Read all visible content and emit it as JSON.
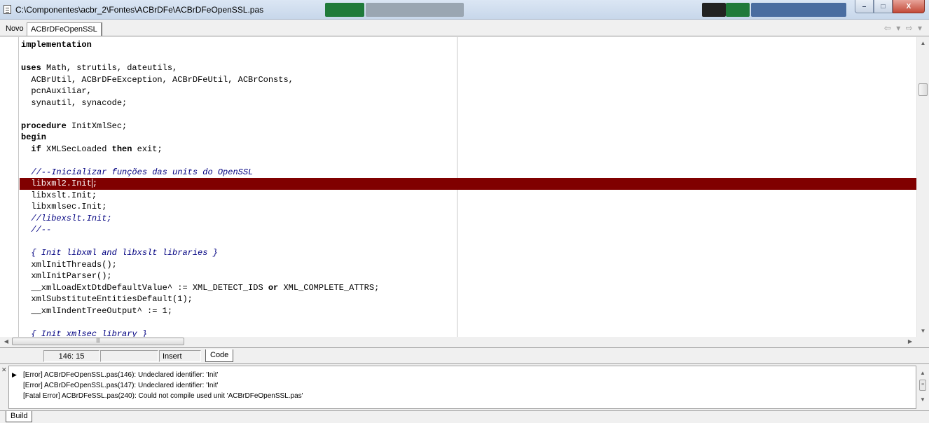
{
  "window": {
    "title": "C:\\Componentes\\acbr_2\\Fontes\\ACBrDFe\\ACBrDFeOpenSSL.pas",
    "minimize": "–",
    "maximize": "□",
    "close": "X"
  },
  "tabs": {
    "new_label": "Novo",
    "active_label": "ACBrDFeOpenSSL",
    "nav": "⇦ ▾ ⇨ ▾"
  },
  "code": {
    "highlight_color": "#800000",
    "lines": [
      "implementation",
      "",
      "uses Math, strutils, dateutils,",
      "  ACBrUtil, ACBrDFeException, ACBrDFeUtil, ACBrConsts,",
      "  pcnAuxiliar,",
      "  synautil, synacode;",
      "",
      "procedure InitXmlSec;",
      "begin",
      "  if XMLSecLoaded then exit;",
      "",
      "  //--Inicializar funções das units do OpenSSL",
      "  libxml2.Init;",
      "  libxslt.Init;",
      "  libxmlsec.Init;",
      "  //libexslt.Init;",
      "  //--",
      "",
      "  { Init libxml and libxslt libraries }",
      "  xmlInitThreads();",
      "  xmlInitParser();",
      "  __xmlLoadExtDtdDefaultValue^ := XML_DETECT_IDS or XML_COMPLETE_ATTRS;",
      "  xmlSubstituteEntitiesDefault(1);",
      "  __xmlIndentTreeOutput^ := 1;",
      "",
      "  { Init xmlsec library }"
    ]
  },
  "status": {
    "position": "146: 15",
    "modified": "",
    "mode": "Insert",
    "code_tab": "Code"
  },
  "messages": {
    "rows": [
      "[Error] ACBrDFeOpenSSL.pas(146): Undeclared identifier: 'Init'",
      "[Error] ACBrDFeOpenSSL.pas(147): Undeclared identifier: 'Init'",
      "[Fatal Error] ACBrDFeSSL.pas(240): Could not compile used unit 'ACBrDFeOpenSSL.pas'"
    ],
    "build_tab": "Build"
  }
}
